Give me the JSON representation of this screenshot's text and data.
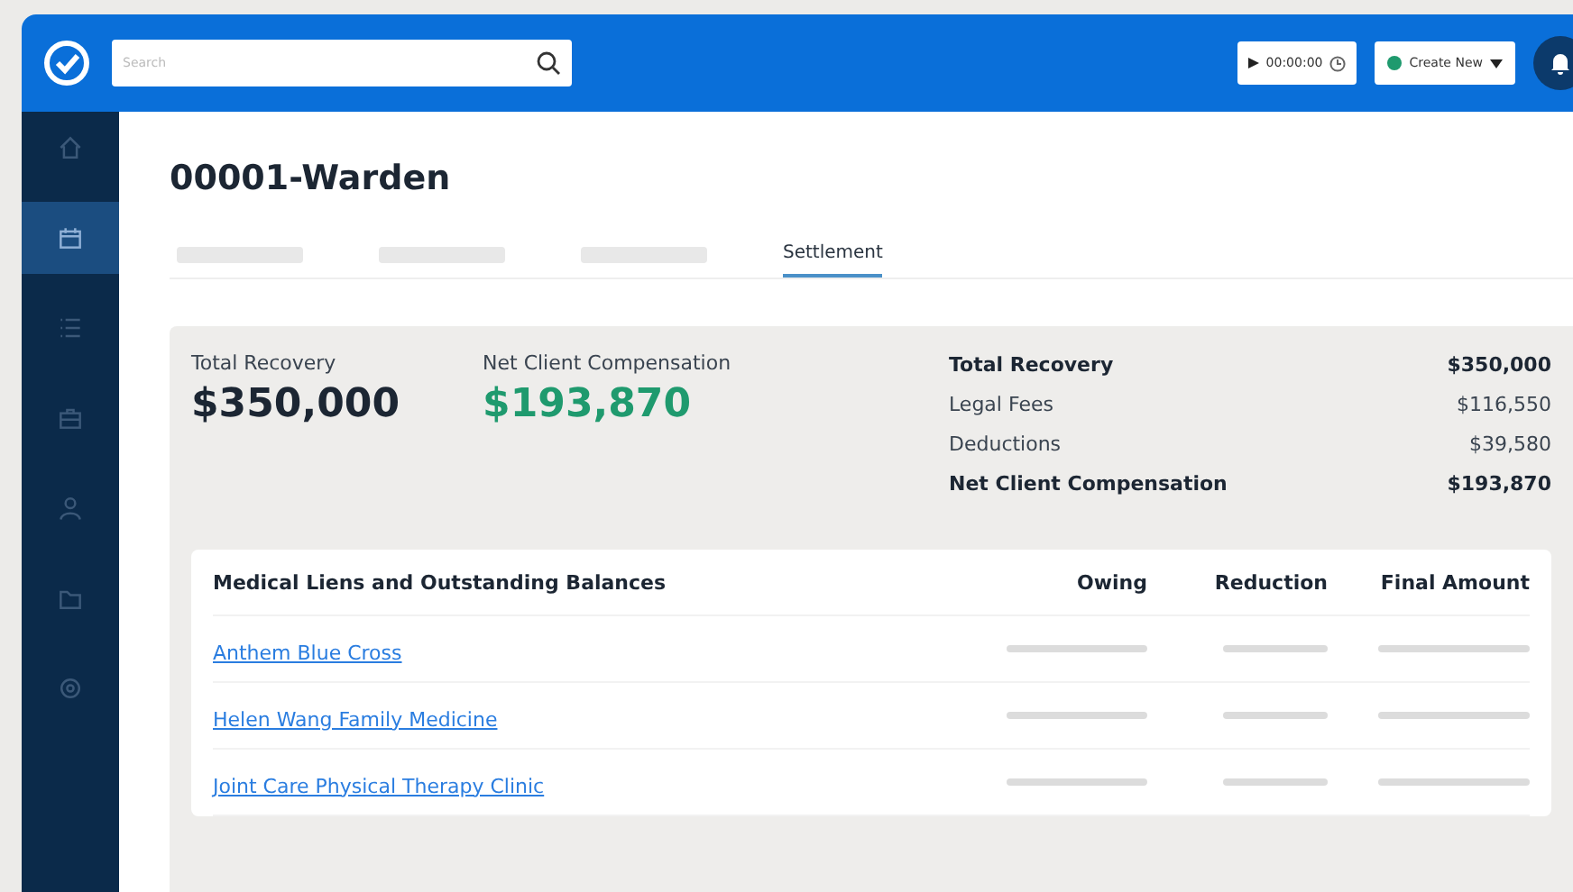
{
  "topbar": {
    "search": {
      "placeholder": "Search"
    },
    "timer": "00:00:00",
    "create_button": "Create New"
  },
  "sidebar": {
    "items": [
      {
        "selected": false
      },
      {
        "selected": true
      },
      {
        "selected": false
      },
      {
        "selected": false
      },
      {
        "selected": false
      },
      {
        "selected": false
      },
      {
        "selected": false
      }
    ]
  },
  "page": {
    "title": "00001-Warden"
  },
  "tabs": [
    {
      "kind": "placeholder",
      "selected": false
    },
    {
      "kind": "placeholder",
      "selected": false
    },
    {
      "kind": "placeholder",
      "selected": false
    },
    {
      "kind": "label",
      "label": "Settlement",
      "selected": true
    }
  ],
  "summary": {
    "stats": [
      {
        "label": "Total Recovery",
        "value": "$350,000",
        "kind": "plain"
      },
      {
        "label": "Net Client Compensation",
        "value": "$193,870",
        "kind": "positive"
      }
    ],
    "breakdown": [
      {
        "label": "Total Recovery",
        "value": "$350,000",
        "bold": true
      },
      {
        "label": "Legal Fees",
        "value": "$116,550",
        "bold": false
      },
      {
        "label": "Deductions",
        "value": "$39,580",
        "bold": false
      },
      {
        "label": "Net Client Compensation",
        "value": "$193,870",
        "bold": true
      }
    ]
  },
  "liens": {
    "columns": [
      "Medical Liens and Outstanding Balances",
      "Owing",
      "Reduction",
      "Final Amount"
    ],
    "rows": [
      {
        "name": "Anthem Blue Cross"
      },
      {
        "name": "Helen Wang Family Medicine"
      },
      {
        "name": "Joint Care Physical Therapy Clinic"
      }
    ]
  }
}
